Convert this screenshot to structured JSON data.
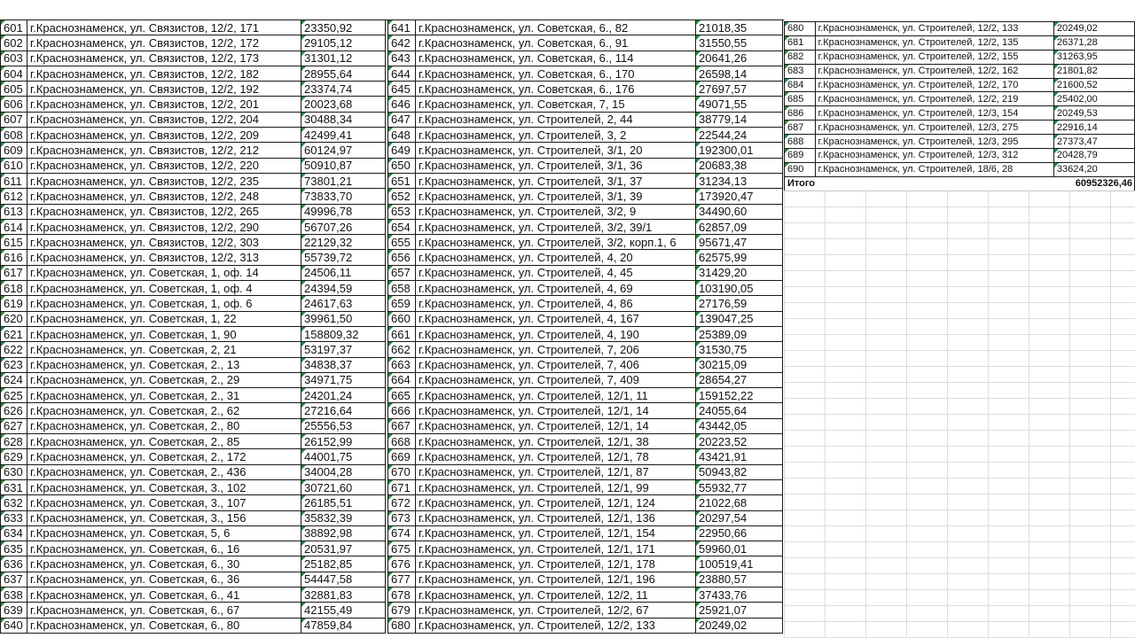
{
  "left_rows": [
    {
      "n": "601",
      "addr": "г.Краснознаменск, ул. Связистов, 12/2, 171",
      "sum": "23350,92"
    },
    {
      "n": "602",
      "addr": "г.Краснознаменск, ул. Связистов, 12/2, 172",
      "sum": "29105,12"
    },
    {
      "n": "603",
      "addr": "г.Краснознаменск, ул. Связистов, 12/2, 173",
      "sum": "31301,12"
    },
    {
      "n": "604",
      "addr": "г.Краснознаменск, ул. Связистов, 12/2, 182",
      "sum": "28955,64"
    },
    {
      "n": "605",
      "addr": "г.Краснознаменск, ул. Связистов, 12/2, 192",
      "sum": "23374,74"
    },
    {
      "n": "606",
      "addr": "г.Краснознаменск, ул. Связистов, 12/2, 201",
      "sum": "20023,68"
    },
    {
      "n": "607",
      "addr": "г.Краснознаменск, ул. Связистов, 12/2, 204",
      "sum": "30488,34"
    },
    {
      "n": "608",
      "addr": "г.Краснознаменск, ул. Связистов, 12/2, 209",
      "sum": "42499,41"
    },
    {
      "n": "609",
      "addr": "г.Краснознаменск, ул. Связистов, 12/2, 212",
      "sum": "60124,97"
    },
    {
      "n": "610",
      "addr": "г.Краснознаменск, ул. Связистов, 12/2, 220",
      "sum": "50910,87"
    },
    {
      "n": "611",
      "addr": "г.Краснознаменск, ул. Связистов, 12/2, 235",
      "sum": "73801,21"
    },
    {
      "n": "612",
      "addr": "г.Краснознаменск, ул. Связистов, 12/2, 248",
      "sum": "73833,70"
    },
    {
      "n": "613",
      "addr": "г.Краснознаменск, ул. Связистов, 12/2, 265",
      "sum": "49996,78"
    },
    {
      "n": "614",
      "addr": "г.Краснознаменск, ул. Связистов, 12/2, 290",
      "sum": "56707,26"
    },
    {
      "n": "615",
      "addr": "г.Краснознаменск, ул. Связистов, 12/2, 303",
      "sum": "22129,32"
    },
    {
      "n": "616",
      "addr": "г.Краснознаменск, ул. Связистов, 12/2, 313",
      "sum": "55739,72"
    },
    {
      "n": "617",
      "addr": "г.Краснознаменск, ул. Советская, 1, оф. 14",
      "sum": "24506,11"
    },
    {
      "n": "618",
      "addr": "г.Краснознаменск, ул. Советская, 1, оф. 4",
      "sum": "24394,59"
    },
    {
      "n": "619",
      "addr": "г.Краснознаменск, ул. Советская, 1, оф. 6",
      "sum": "24617,63"
    },
    {
      "n": "620",
      "addr": "г.Краснознаменск, ул. Советская, 1, 22",
      "sum": "39961,50"
    },
    {
      "n": "621",
      "addr": "г.Краснознаменск, ул. Советская, 1, 90",
      "sum": "158809,32"
    },
    {
      "n": "622",
      "addr": "г.Краснознаменск, ул. Советская, 2, 21",
      "sum": "53197,37"
    },
    {
      "n": "623",
      "addr": "г.Краснознаменск, ул. Советская, 2., 13",
      "sum": "34838,37"
    },
    {
      "n": "624",
      "addr": "г.Краснознаменск, ул. Советская, 2., 29",
      "sum": "34971,75"
    },
    {
      "n": "625",
      "addr": "г.Краснознаменск, ул. Советская, 2., 31",
      "sum": "24201,24"
    },
    {
      "n": "626",
      "addr": "г.Краснознаменск, ул. Советская, 2., 62",
      "sum": "27216,64"
    },
    {
      "n": "627",
      "addr": "г.Краснознаменск, ул. Советская, 2., 80",
      "sum": "25556,53"
    },
    {
      "n": "628",
      "addr": "г.Краснознаменск, ул. Советская, 2., 85",
      "sum": "26152,99"
    },
    {
      "n": "629",
      "addr": "г.Краснознаменск, ул. Советская, 2., 172",
      "sum": "44001,75"
    },
    {
      "n": "630",
      "addr": "г.Краснознаменск, ул. Советская, 2., 436",
      "sum": "34004,28"
    },
    {
      "n": "631",
      "addr": "г.Краснознаменск, ул. Советская, 3., 102",
      "sum": "30721,60"
    },
    {
      "n": "632",
      "addr": "г.Краснознаменск, ул. Советская, 3., 107",
      "sum": "26185,51"
    },
    {
      "n": "633",
      "addr": "г.Краснознаменск, ул. Советская, 3., 156",
      "sum": "35832,39"
    },
    {
      "n": "634",
      "addr": "г.Краснознаменск, ул. Советская, 5, 6",
      "sum": "38892,98"
    },
    {
      "n": "635",
      "addr": "г.Краснознаменск, ул. Советская, 6., 16",
      "sum": "20531,97"
    },
    {
      "n": "636",
      "addr": "г.Краснознаменск, ул. Советская, 6., 30",
      "sum": "25182,85"
    },
    {
      "n": "637",
      "addr": "г.Краснознаменск, ул. Советская, 6., 36",
      "sum": "54447,58"
    },
    {
      "n": "638",
      "addr": "г.Краснознаменск, ул. Советская, 6., 41",
      "sum": "32881,83"
    },
    {
      "n": "639",
      "addr": "г.Краснознаменск, ул. Советская, 6., 67",
      "sum": "42155,49"
    },
    {
      "n": "640",
      "addr": "г.Краснознаменск, ул. Советская, 6., 80",
      "sum": "47859,84"
    }
  ],
  "middle_rows": [
    {
      "n": "641",
      "addr": "г.Краснознаменск, ул. Советская, 6., 82",
      "sum": "21018,35"
    },
    {
      "n": "642",
      "addr": "г.Краснознаменск, ул. Советская, 6., 91",
      "sum": "31550,55"
    },
    {
      "n": "643",
      "addr": "г.Краснознаменск, ул. Советская, 6., 114",
      "sum": "20641,26"
    },
    {
      "n": "644",
      "addr": "г.Краснознаменск, ул. Советская, 6., 170",
      "sum": "26598,14"
    },
    {
      "n": "645",
      "addr": "г.Краснознаменск, ул. Советская, 6., 176",
      "sum": "27697,57"
    },
    {
      "n": "646",
      "addr": "г.Краснознаменск, ул. Советская, 7, 15",
      "sum": "49071,55"
    },
    {
      "n": "647",
      "addr": "г.Краснознаменск, ул. Строителей, 2, 44",
      "sum": "38779,14"
    },
    {
      "n": "648",
      "addr": "г.Краснознаменск, ул. Строителей, 3, 2",
      "sum": "22544,24"
    },
    {
      "n": "649",
      "addr": "г.Краснознаменск, ул. Строителей, 3/1, 20",
      "sum": "192300,01"
    },
    {
      "n": "650",
      "addr": "г.Краснознаменск, ул. Строителей, 3/1, 36",
      "sum": "20683,38"
    },
    {
      "n": "651",
      "addr": "г.Краснознаменск, ул. Строителей, 3/1, 37",
      "sum": "31234,13"
    },
    {
      "n": "652",
      "addr": "г.Краснознаменск, ул. Строителей, 3/1, 39",
      "sum": "173920,47"
    },
    {
      "n": "653",
      "addr": "г.Краснознаменск, ул. Строителей, 3/2, 9",
      "sum": "34490,60"
    },
    {
      "n": "654",
      "addr": "г.Краснознаменск, ул. Строителей, 3/2, 39/1",
      "sum": "62857,09"
    },
    {
      "n": "655",
      "addr": "г.Краснознаменск, ул. Строителей, 3/2, корп.1, 6",
      "sum": "95671,47"
    },
    {
      "n": "656",
      "addr": "г.Краснознаменск, ул. Строителей, 4, 20",
      "sum": "62575,99"
    },
    {
      "n": "657",
      "addr": "г.Краснознаменск, ул. Строителей, 4, 45",
      "sum": "31429,20"
    },
    {
      "n": "658",
      "addr": "г.Краснознаменск, ул. Строителей, 4, 69",
      "sum": "103190,05"
    },
    {
      "n": "659",
      "addr": "г.Краснознаменск, ул. Строителей, 4, 86",
      "sum": "27176,59"
    },
    {
      "n": "660",
      "addr": "г.Краснознаменск, ул. Строителей, 4, 167",
      "sum": "139047,25"
    },
    {
      "n": "661",
      "addr": "г.Краснознаменск, ул. Строителей, 4, 190",
      "sum": "25389,09"
    },
    {
      "n": "662",
      "addr": "г.Краснознаменск, ул. Строителей, 7, 206",
      "sum": "31530,75"
    },
    {
      "n": "663",
      "addr": "г.Краснознаменск, ул. Строителей, 7, 406",
      "sum": "30215,09"
    },
    {
      "n": "664",
      "addr": "г.Краснознаменск, ул. Строителей, 7, 409",
      "sum": "28654,27"
    },
    {
      "n": "665",
      "addr": "г.Краснознаменск, ул. Строителей, 12/1, 11",
      "sum": "159152,22"
    },
    {
      "n": "666",
      "addr": "г.Краснознаменск, ул. Строителей, 12/1, 14",
      "sum": "24055,64"
    },
    {
      "n": "667",
      "addr": "г.Краснознаменск, ул. Строителей, 12/1, 14",
      "sum": "43442,05"
    },
    {
      "n": "668",
      "addr": "г.Краснознаменск, ул. Строителей, 12/1, 38",
      "sum": "20223,52"
    },
    {
      "n": "669",
      "addr": "г.Краснознаменск, ул. Строителей, 12/1, 78",
      "sum": "43421,91"
    },
    {
      "n": "670",
      "addr": "г.Краснознаменск, ул. Строителей, 12/1, 87",
      "sum": "50943,82"
    },
    {
      "n": "671",
      "addr": "г.Краснознаменск, ул. Строителей, 12/1, 99",
      "sum": "55932,77"
    },
    {
      "n": "672",
      "addr": "г.Краснознаменск, ул. Строителей, 12/1, 124",
      "sum": "21022,68"
    },
    {
      "n": "673",
      "addr": "г.Краснознаменск, ул. Строителей, 12/1, 136",
      "sum": "20297,54"
    },
    {
      "n": "674",
      "addr": "г.Краснознаменск, ул. Строителей, 12/1, 154",
      "sum": "22950,66"
    },
    {
      "n": "675",
      "addr": "г.Краснознаменск, ул. Строителей, 12/1, 171",
      "sum": "59960,01"
    },
    {
      "n": "676",
      "addr": "г.Краснознаменск, ул. Строителей, 12/1, 178",
      "sum": "100519,41"
    },
    {
      "n": "677",
      "addr": "г.Краснознаменск, ул. Строителей, 12/1, 196",
      "sum": "23880,57"
    },
    {
      "n": "678",
      "addr": "г.Краснознаменск, ул. Строителей, 12/2, 11",
      "sum": "37433,76"
    },
    {
      "n": "679",
      "addr": "г.Краснознаменск, ул. Строителей, 12/2, 67",
      "sum": "25921,07"
    },
    {
      "n": "680",
      "addr": "г.Краснознаменск, ул. Строителей, 12/2, 133",
      "sum": "20249,02"
    }
  ],
  "right_rows": [
    {
      "n": "680",
      "addr": "г.Краснознаменск, ул. Строителей, 12/2, 133",
      "sum": "20249,02"
    },
    {
      "n": "681",
      "addr": "г.Краснознаменск, ул. Строителей, 12/2, 135",
      "sum": "26371,28"
    },
    {
      "n": "682",
      "addr": "г.Краснознаменск, ул. Строителей, 12/2, 155",
      "sum": "31263,95"
    },
    {
      "n": "683",
      "addr": "г.Краснознаменск, ул. Строителей, 12/2, 162",
      "sum": "21801,82"
    },
    {
      "n": "684",
      "addr": "г.Краснознаменск, ул. Строителей, 12/2, 170",
      "sum": "21600,52"
    },
    {
      "n": "685",
      "addr": "г.Краснознаменск, ул. Строителей, 12/2, 219",
      "sum": "25402,00"
    },
    {
      "n": "686",
      "addr": "г.Краснознаменск, ул. Строителей, 12/3, 154",
      "sum": "20249,53"
    },
    {
      "n": "687",
      "addr": "г.Краснознаменск, ул. Строителей, 12/3, 275",
      "sum": "22916,14"
    },
    {
      "n": "688",
      "addr": "г.Краснознаменск, ул. Строителей, 12/3, 295",
      "sum": "27373,47"
    },
    {
      "n": "689",
      "addr": "г.Краснознаменск, ул. Строителей, 12/3, 312",
      "sum": "20428,79"
    },
    {
      "n": "690",
      "addr": "г.Краснознаменск, ул. Строителей, 18/6, 28",
      "sum": "33624,20"
    }
  ],
  "total": {
    "label": "Итого",
    "value": "60952326,46"
  }
}
